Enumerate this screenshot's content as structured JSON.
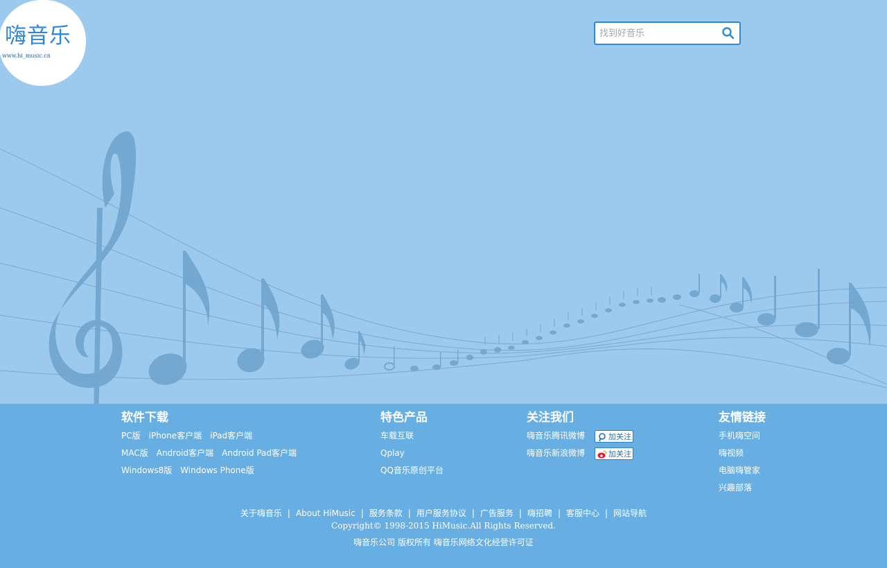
{
  "logo": {
    "main": "嗨音乐",
    "url": "www.hi_music.cn"
  },
  "search": {
    "placeholder": "找到好音乐"
  },
  "footer": {
    "software": {
      "title": "软件下载",
      "rows": [
        [
          "PC版",
          "iPhone客户端",
          "iPad客户端"
        ],
        [
          "MAC版",
          "Android客户端",
          "Android Pad客户端"
        ],
        [
          "Windows8版",
          "Windows Phone版"
        ]
      ]
    },
    "products": {
      "title": "特色产品",
      "items": [
        "车载互联",
        "Qplay",
        "QQ音乐原创平台"
      ]
    },
    "follow": {
      "title": "关注我们",
      "items": [
        {
          "label": "嗨音乐腾讯微博",
          "button": "加关注",
          "icon": "tencent-weibo-icon"
        },
        {
          "label": "嗨音乐新浪微博",
          "button": "加关注",
          "icon": "sina-weibo-icon"
        }
      ]
    },
    "friends": {
      "title": "友情链接",
      "items": [
        "手机嗨空间",
        "嗨视频",
        "电脑嗨管家",
        "兴趣部落"
      ]
    },
    "bottom_links": [
      "关于嗨音乐",
      "About HiMusic",
      "服务条款",
      "用户服务协议",
      "广告服务",
      "嗨招聘",
      "客服中心",
      "网站导航"
    ],
    "copyright": "Copyright© 1998-2015 HiMusic.All Rights Reserved.",
    "license": "嗨音乐公司 版权所有 嗨音乐网络文化经营许可证"
  },
  "colors": {
    "background": "#9ccaee",
    "footer": "#67aee3",
    "accent": "#2d8ad6",
    "notes": "#6fa3cb"
  }
}
